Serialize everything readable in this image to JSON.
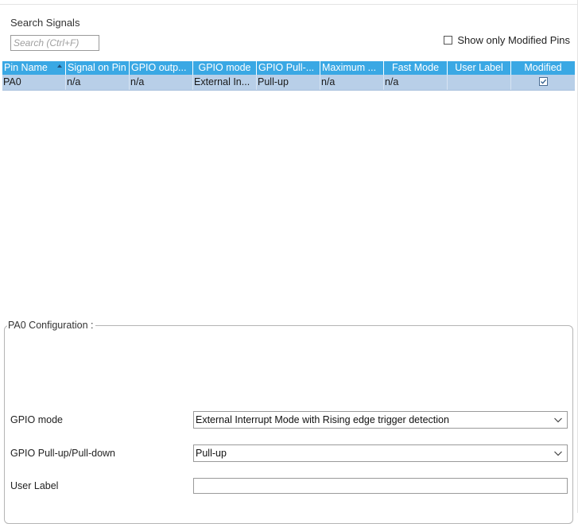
{
  "search": {
    "label": "Search Signals",
    "placeholder": "Search (Ctrl+F)",
    "value": ""
  },
  "filter": {
    "show_modified_label": "Show only Modified Pins",
    "checked": false
  },
  "table": {
    "columns": [
      "Pin Name",
      "Signal on Pin",
      "GPIO outp...",
      "GPIO mode",
      "GPIO Pull-...",
      "Maximum ...",
      "Fast Mode",
      "User Label",
      "Modified"
    ],
    "sort_column": "Pin Name",
    "rows": [
      {
        "pin_name": "PA0",
        "signal": "n/a",
        "gpio_output": "n/a",
        "gpio_mode": "External In...",
        "gpio_pull": "Pull-up",
        "maximum": "n/a",
        "fast_mode": "n/a",
        "user_label": "",
        "modified": true
      }
    ]
  },
  "config": {
    "title": "PA0 Configuration :",
    "gpio_mode_label": "GPIO mode",
    "gpio_mode_value": "External Interrupt Mode with Rising edge trigger detection",
    "gpio_pull_label": "GPIO Pull-up/Pull-down",
    "gpio_pull_value": "Pull-up",
    "user_label_label": "User Label",
    "user_label_value": ""
  },
  "colors": {
    "header_bg": "#3aa8e4",
    "selected_row_bg": "#b8cfe8"
  }
}
